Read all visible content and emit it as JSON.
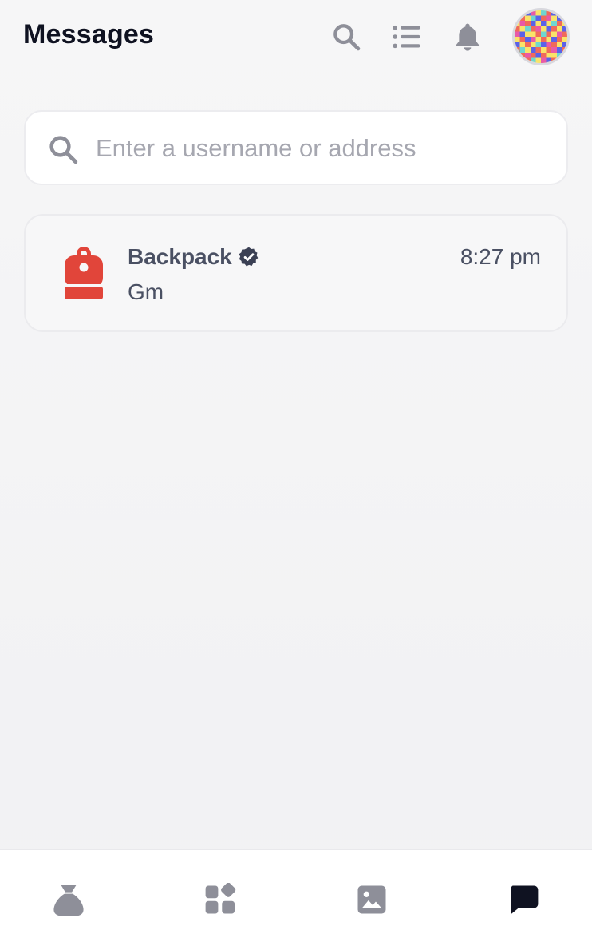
{
  "header": {
    "title": "Messages",
    "icons": [
      "search-icon",
      "list-icon",
      "bell-icon"
    ]
  },
  "search": {
    "placeholder": "Enter a username or address",
    "value": ""
  },
  "conversations": [
    {
      "name": "Backpack",
      "verified": true,
      "preview": "Gm",
      "time": "8:27 pm",
      "avatar_icon": "backpack-logo-icon"
    }
  ],
  "tabbar": {
    "items": [
      {
        "icon": "balances-bag-icon",
        "active": false
      },
      {
        "icon": "apps-grid-icon",
        "active": false
      },
      {
        "icon": "collectibles-image-icon",
        "active": false
      },
      {
        "icon": "messages-icon",
        "active": true
      }
    ]
  },
  "colors": {
    "title": "#0f1221",
    "icon_gray": "#8e8f99",
    "text_secondary": "#4a5063",
    "placeholder": "#a6a7b0",
    "brand_red": "#e1453a",
    "active_tab": "#0f1221"
  }
}
